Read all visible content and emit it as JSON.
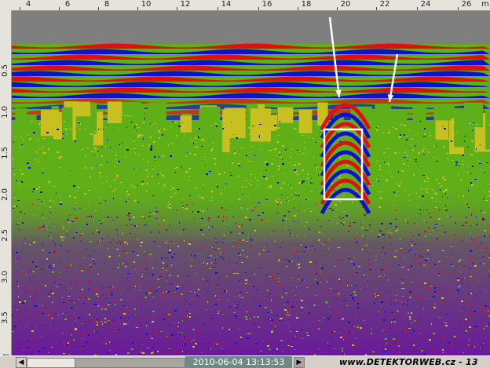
{
  "ruler": {
    "x_unit": "m",
    "y_unit": "m",
    "x_labels": [
      "4",
      "6",
      "8",
      "10",
      "12",
      "14",
      "16",
      "18",
      "20",
      "22",
      "24",
      "26"
    ],
    "y_labels": [
      "0.5",
      "1.0",
      "1.5",
      "2.0",
      "2.5",
      "3.0",
      "3.5"
    ]
  },
  "status": {
    "date": "2010-06-04",
    "time": "13:13:53",
    "datetime": "2010-06-04   13:13:53",
    "watermark": "www.DETEKTORWEB.cz - 13",
    "left_arrow": "◀",
    "right_arrow": "▶"
  },
  "colors": {
    "air": "#7f7f7f",
    "red": "#e01010",
    "blue": "#1010d0",
    "green": "#5faf18",
    "yellow": "#c8c020",
    "purple": "#6a1a9a",
    "annotation": "#ffffff"
  }
}
